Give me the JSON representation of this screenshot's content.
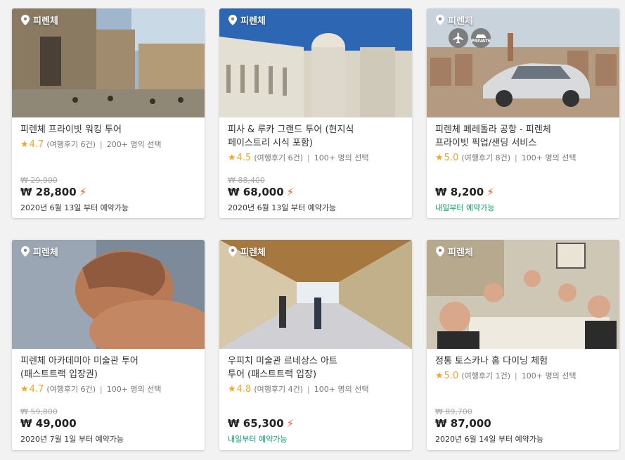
{
  "cards": [
    {
      "location": "피렌체",
      "title_line1": "피렌체 프라이빗 워킹 투어",
      "title_line2": "",
      "rating": "4.7",
      "reviews": "(여행후기 6건)",
      "chosen": "200+ 명의 선택",
      "original_price": "₩ 29,900",
      "price": "₩ 28,800",
      "instant": true,
      "availability": "2020년 6월 13일 부터 예약가능"
    },
    {
      "location": "피렌체",
      "title_line1": "피사 & 루카 그랜드 투어 (현지식",
      "title_line2": "페이스트리 시식 포함)",
      "rating": "4.5",
      "reviews": "(여행후기 6건)",
      "chosen": "100+ 명의 선택",
      "original_price": "₩ 88,400",
      "price": "₩ 68,000",
      "instant": true,
      "availability": "2020년 6월 13일 부터 예약가능"
    },
    {
      "location": "피렌체",
      "title_line1": "피렌체 페레톨라 공항 - 피렌체",
      "title_line2": "프라이빗 픽업/샌딩 서비스",
      "rating": "5.0",
      "reviews": "(여행후기 8건)",
      "chosen": "100+ 명의 선택",
      "original_price": "",
      "price": "₩ 8,200",
      "instant": true,
      "availability": "내일부터 예약가능",
      "badges": [
        "airplane-icon",
        "private-car-icon"
      ],
      "badge_private_text": "PRIVATE"
    },
    {
      "location": "피렌체",
      "title_line1": "피렌체 아카데미아 미술관 투어",
      "title_line2": "(패스트트랙 입장권)",
      "rating": "4.7",
      "reviews": "(여행후기 6건)",
      "chosen": "100+ 명의 선택",
      "original_price": "₩ 59,800",
      "price": "₩ 49,000",
      "instant": false,
      "availability": "2020년 7월 1일 부터 예약가능"
    },
    {
      "location": "피렌체",
      "title_line1": "우피치 미술관 르네상스 아트",
      "title_line2": "투어 (패스트트랙 입장)",
      "rating": "4.8",
      "reviews": "(여행후기 4건)",
      "chosen": "100+ 명의 선택",
      "original_price": "",
      "price": "₩ 65,300",
      "instant": true,
      "availability": "내일부터 예약가능"
    },
    {
      "location": "피렌체",
      "title_line1": "정통 토스카나 홈 다이닝 체험",
      "title_line2": "",
      "rating": "5.0",
      "reviews": "(여행후기 1건)",
      "chosen": "100+ 명의 선택",
      "original_price": "₩ 89,700",
      "price": "₩ 87,000",
      "instant": false,
      "availability": "2020년 6월 14일 부터 예약가능"
    }
  ],
  "colors": {
    "star": "#f5a623",
    "instant_bolt": "#ff5722",
    "available_green": "#0aa36b"
  }
}
